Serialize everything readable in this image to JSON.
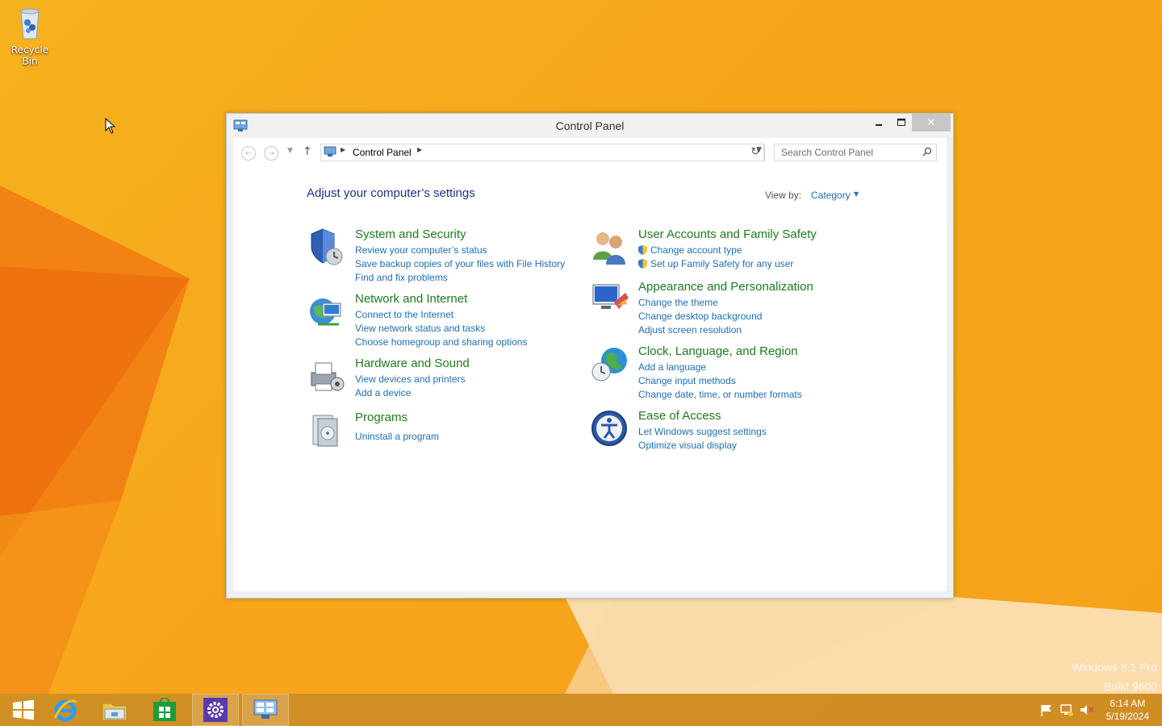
{
  "desktop": {
    "recycle_bin_label": "Recycle Bin",
    "watermark_line1": "Windows 8.1 Pro",
    "watermark_line2": "Build 9600"
  },
  "window": {
    "title": "Control Panel",
    "address_path": "Control Panel",
    "search_placeholder": "Search Control Panel",
    "heading": "Adjust your computer’s settings",
    "view_by_label": "View by:",
    "view_by_value": "Category"
  },
  "categories_left": [
    {
      "title": "System and Security",
      "links": [
        "Review your computer’s status",
        "Save backup copies of your files with File History",
        "Find and fix problems"
      ]
    },
    {
      "title": "Network and Internet",
      "links": [
        "Connect to the Internet",
        "View network status and tasks",
        "Choose homegroup and sharing options"
      ]
    },
    {
      "title": "Hardware and Sound",
      "links": [
        "View devices and printers",
        "Add a device"
      ]
    },
    {
      "title": "Programs",
      "links": [
        "Uninstall a program"
      ]
    }
  ],
  "categories_right": [
    {
      "title": "User Accounts and Family Safety",
      "links": [
        "Change account type",
        "Set up Family Safety for any user"
      ]
    },
    {
      "title": "Appearance and Personalization",
      "links": [
        "Change the theme",
        "Change desktop background",
        "Adjust screen resolution"
      ]
    },
    {
      "title": "Clock, Language, and Region",
      "links": [
        "Add a language",
        "Change input methods",
        "Change date, time, or number formats"
      ]
    },
    {
      "title": "Ease of Access",
      "links": [
        "Let Windows suggest settings",
        "Optimize visual display"
      ]
    }
  ],
  "taskbar": {
    "apps": [
      "start-icon",
      "internet-explorer-icon",
      "file-explorer-icon",
      "store-icon",
      "settings-icon",
      "control-panel-icon"
    ],
    "time": "6:14 AM",
    "date": "5/19/2024"
  },
  "colors": {
    "category_title": "#1e7a1e",
    "link": "#1e6eb4",
    "heading": "#1e3287"
  }
}
